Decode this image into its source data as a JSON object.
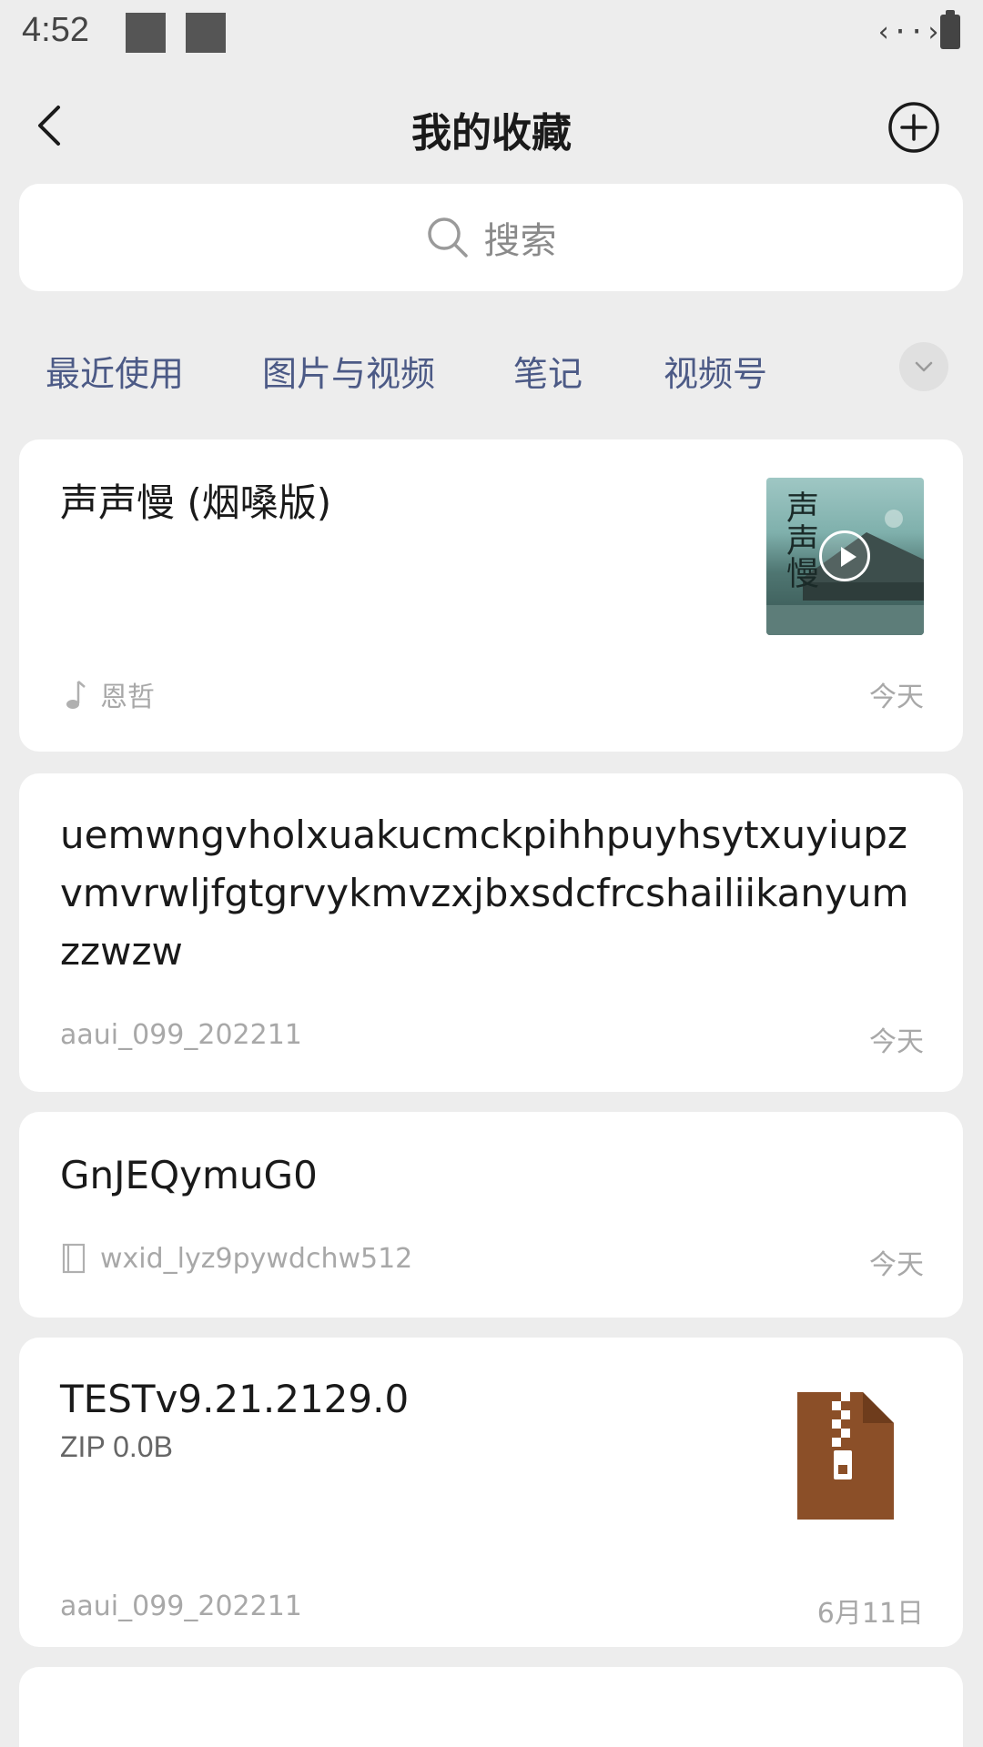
{
  "status_bar": {
    "time": "4:52",
    "link_glyph": "‹··›"
  },
  "header": {
    "title": "我的收藏"
  },
  "search": {
    "placeholder": "搜索"
  },
  "tabs": [
    "最近使用",
    "图片与视频",
    "笔记",
    "视频号"
  ],
  "items": [
    {
      "title": "声声慢 (烟嗓版)",
      "source": "恩哲",
      "date": "今天",
      "icon": "music-note-icon",
      "thumbnail_text": "声声慢"
    },
    {
      "title": "uemwngvholxuakucmckpihhpuyhsytxuyiupzvmvrwljfgtgrvykmvzxjbxsdcfrcshailiikanyumzzwzw",
      "source": "aaui_099_202211",
      "date": "今天"
    },
    {
      "title": "GnJEQymuG0",
      "source": "wxid_lyz9pywdchw512",
      "date": "今天",
      "icon": "note-icon"
    },
    {
      "title": "TESTv9.21.2129.0",
      "subtitle": "ZIP 0.0B",
      "source": "aaui_099_202211",
      "date": "6月11日",
      "icon": "zip-file-icon"
    }
  ],
  "colors": {
    "tab_text": "#4c5a86",
    "background": "#ededed",
    "zip_brown": "#8b4f28"
  }
}
